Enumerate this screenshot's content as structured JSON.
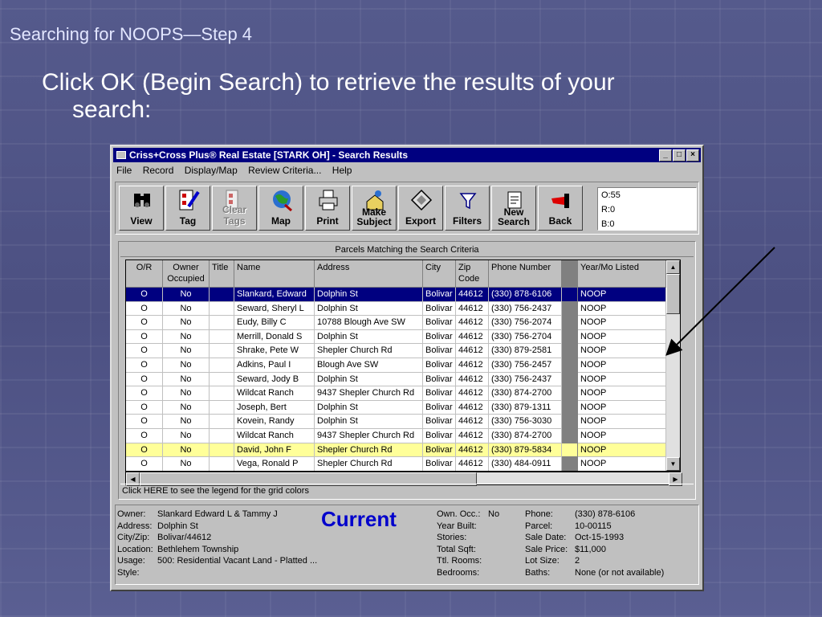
{
  "slide": {
    "heading": "Searching for NOOPS—Step 4",
    "bullet_line1": "Click OK (Begin Search) to retrieve the results of your",
    "bullet_line2": "search:"
  },
  "window": {
    "title": "Criss+Cross Plus® Real Estate [STARK OH] - Search Results",
    "menu": [
      "File",
      "Record",
      "Display/Map",
      "Review Criteria...",
      "Help"
    ],
    "tools": [
      {
        "label": "View",
        "icon": "binoculars-icon"
      },
      {
        "label": "Tag",
        "icon": "tag-checklist-icon"
      },
      {
        "label": "Clear Tags",
        "icon": "clear-tags-icon",
        "disabled": true
      },
      {
        "label": "Map",
        "icon": "globe-map-icon"
      },
      {
        "label": "Print",
        "icon": "printer-icon"
      },
      {
        "label": "Make Subject",
        "icon": "make-subject-icon"
      },
      {
        "label": "Export",
        "icon": "export-diamond-icon"
      },
      {
        "label": "Filters",
        "icon": "filter-funnel-icon"
      },
      {
        "label": "New Search",
        "icon": "new-search-icon"
      },
      {
        "label": "Back",
        "icon": "back-hand-icon"
      }
    ],
    "counts": {
      "o": "O:55",
      "r": "R:0",
      "b": "B:0"
    }
  },
  "grid": {
    "caption": "Parcels Matching the Search Criteria",
    "headers": [
      "O/R",
      "Owner Occupied",
      "Title",
      "Name",
      "Address",
      "City",
      "Zip Code",
      "Phone Number",
      "",
      "Year/Mo Listed"
    ],
    "rows": [
      [
        "O",
        "No",
        "",
        "Slankard, Edward",
        "Dolphin St",
        "Bolivar",
        "44612",
        "(330) 878-6106",
        "",
        "NOOP"
      ],
      [
        "O",
        "No",
        "",
        "Seward, Sheryl L",
        "Dolphin St",
        "Bolivar",
        "44612",
        "(330) 756-2437",
        "",
        "NOOP"
      ],
      [
        "O",
        "No",
        "",
        "Eudy, Billy C",
        "10788 Blough Ave SW",
        "Bolivar",
        "44612",
        "(330) 756-2074",
        "",
        "NOOP"
      ],
      [
        "O",
        "No",
        "",
        "Merrill, Donald S",
        "Dolphin St",
        "Bolivar",
        "44612",
        "(330) 756-2704",
        "",
        "NOOP"
      ],
      [
        "O",
        "No",
        "",
        "Shrake, Pete W",
        "Shepler Church Rd",
        "Bolivar",
        "44612",
        "(330) 879-2581",
        "",
        "NOOP"
      ],
      [
        "O",
        "No",
        "",
        "Adkins, Paul I",
        "Blough Ave SW",
        "Bolivar",
        "44612",
        "(330) 756-2457",
        "",
        "NOOP"
      ],
      [
        "O",
        "No",
        "",
        "Seward, Jody B",
        "Dolphin St",
        "Bolivar",
        "44612",
        "(330) 756-2437",
        "",
        "NOOP"
      ],
      [
        "O",
        "No",
        "",
        "Wildcat Ranch",
        "9437 Shepler Church Rd",
        "Bolivar",
        "44612",
        "(330) 874-2700",
        "",
        "NOOP"
      ],
      [
        "O",
        "No",
        "",
        "Joseph, Bert",
        "Dolphin St",
        "Bolivar",
        "44612",
        "(330) 879-1311",
        "",
        "NOOP"
      ],
      [
        "O",
        "No",
        "",
        "Kovein, Randy",
        "Dolphin St",
        "Bolivar",
        "44612",
        "(330) 756-3030",
        "",
        "NOOP"
      ],
      [
        "O",
        "No",
        "",
        "Wildcat Ranch",
        "9437 Shepler Church Rd",
        "Bolivar",
        "44612",
        "(330) 874-2700",
        "",
        "NOOP"
      ],
      [
        "O",
        "No",
        "",
        "David, John F",
        "Shepler Church Rd",
        "Bolivar",
        "44612",
        "(330) 879-5834",
        "",
        "NOOP"
      ],
      [
        "O",
        "No",
        "",
        "Vega, Ronald P",
        "Shepler Church Rd",
        "Bolivar",
        "44612",
        "(330) 484-0911",
        "",
        "NOOP"
      ]
    ],
    "selected_row": 0,
    "highlight_row": 11,
    "highlight_color": "#ffff99",
    "selected_color": "#000080",
    "legend_text": "Click HERE to see the legend for the grid colors"
  },
  "details": {
    "col1": [
      {
        "k": "Owner:",
        "v": "Slankard Edward L & Tammy J"
      },
      {
        "k": "Address:",
        "v": "Dolphin St"
      },
      {
        "k": "City/Zip:",
        "v": "Bolivar/44612"
      },
      {
        "k": "Location:",
        "v": "Bethlehem Township"
      },
      {
        "k": "Usage:",
        "v": "500:  Residential Vacant Land - Platted ..."
      },
      {
        "k": "Style:",
        "v": ""
      }
    ],
    "status": "Current",
    "col2": [
      {
        "k": "Own. Occ.:",
        "v": "No"
      },
      {
        "k": "Year Built:",
        "v": ""
      },
      {
        "k": "Stories:",
        "v": ""
      },
      {
        "k": "Total Sqft:",
        "v": ""
      },
      {
        "k": "Ttl. Rooms:",
        "v": ""
      },
      {
        "k": "Bedrooms:",
        "v": ""
      }
    ],
    "col3": [
      {
        "k": "Phone:",
        "v": "(330) 878-6106"
      },
      {
        "k": "Parcel:",
        "v": "10-00115"
      },
      {
        "k": "Sale Date:",
        "v": "Oct-15-1993"
      },
      {
        "k": "Sale Price:",
        "v": "$11,000"
      },
      {
        "k": "Lot Size:",
        "v": "2"
      },
      {
        "k": "Baths:",
        "v": "None (or not available)"
      }
    ]
  }
}
